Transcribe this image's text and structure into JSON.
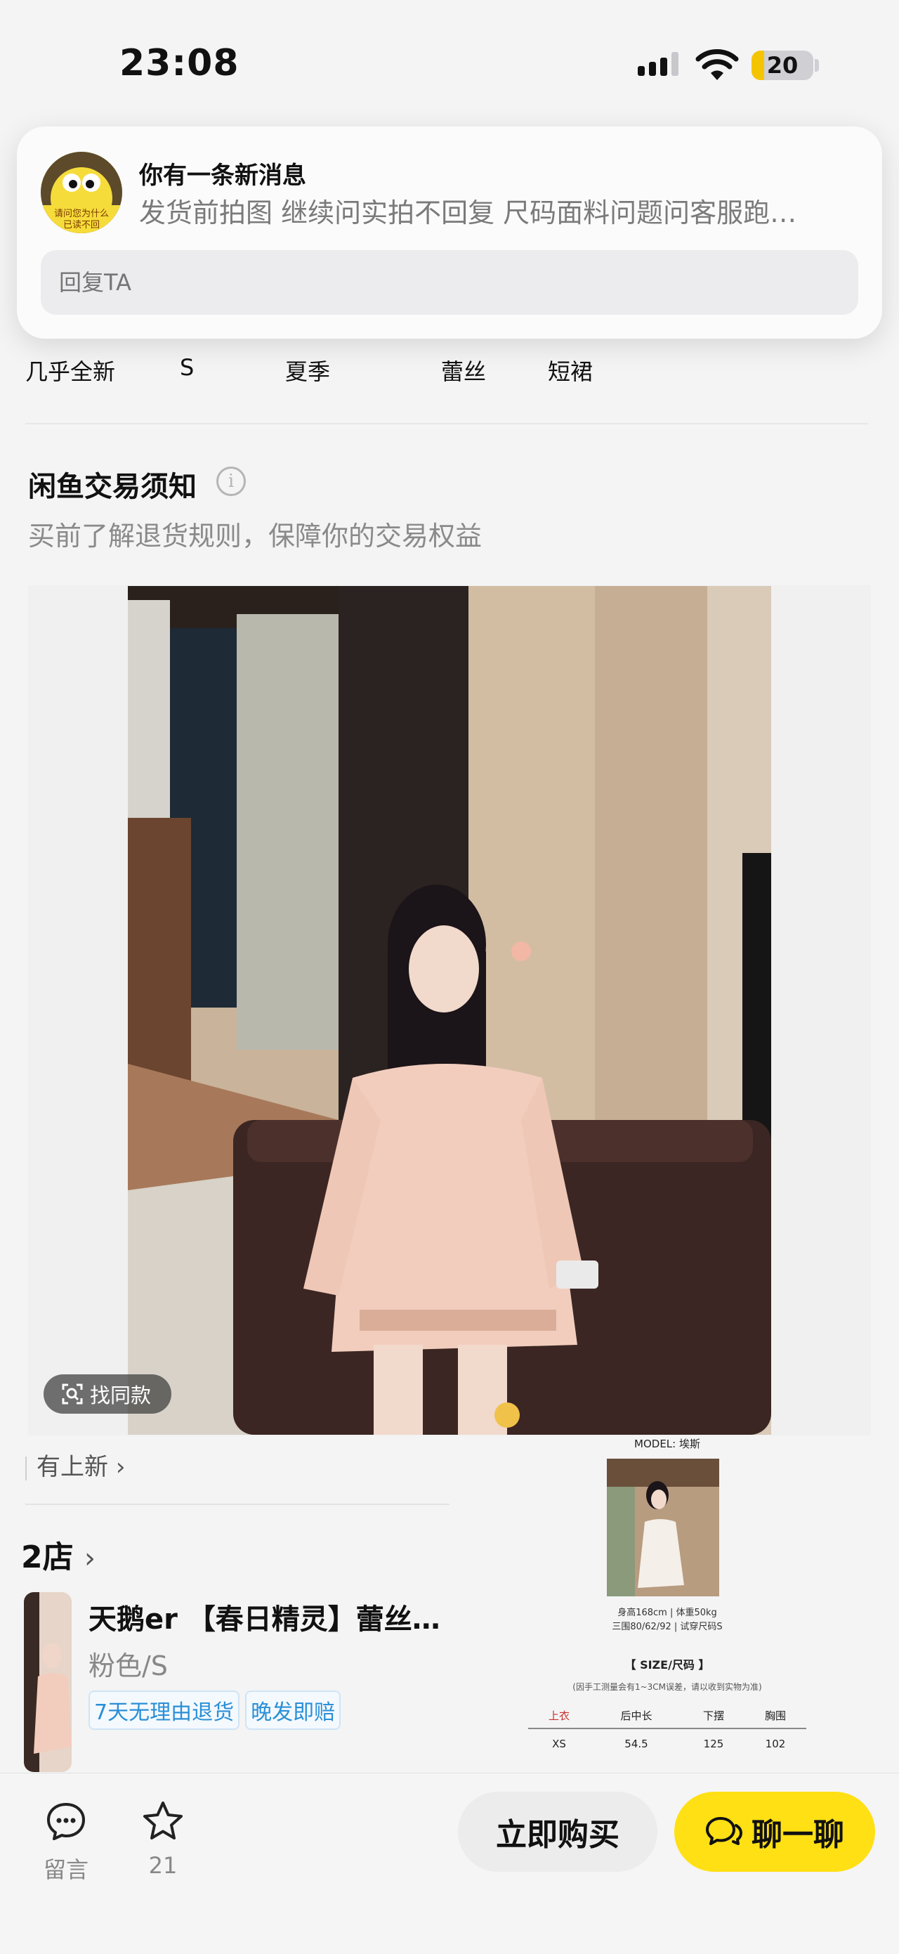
{
  "status_bar": {
    "time": "23:08",
    "battery": "20",
    "battery_level": 0.2
  },
  "notification": {
    "title": "你有一条新消息",
    "message": "发货前拍图 继续问实拍不回复 尺码面料问题问客服跑…",
    "avatar_text_1": "请问您为什么",
    "avatar_text_2": "已读不回",
    "reply_placeholder": "回复TA"
  },
  "tags": [
    "几乎全新",
    "S",
    "夏季",
    "蕾丝",
    "短裙"
  ],
  "rules": {
    "title": "闲鱼交易须知",
    "subtitle": "买前了解退货规则，保障你的交易权益"
  },
  "gallery": {
    "find_same_label": "找同款"
  },
  "shop": {
    "new_arrivals_label": "有上新",
    "name": "2店"
  },
  "product": {
    "title": "天鹅er 【春日精灵】蕾丝…",
    "spec": "粉色/S",
    "badges": [
      "7天无理由退货",
      "晚发即赔"
    ]
  },
  "size_chart": {
    "model_label": "MODEL: 埃斯",
    "stats_1": "身高168cm | 体重50kg",
    "stats_2": "三围80/62/92 | 试穿尺码S",
    "title": "【 SIZE/尺码 】",
    "note": "(因手工测量会有1~3CM误差，请以收到实物为准)",
    "headers": [
      "上衣",
      "后中长",
      "下摆",
      "胸围"
    ],
    "rows": [
      [
        "XS",
        "54.5",
        "125",
        "102"
      ]
    ]
  },
  "bottom_bar": {
    "comment_label": "留言",
    "favorite_count": "21",
    "buy_label": "立即购买",
    "chat_label": "聊一聊"
  },
  "colors": {
    "accent": "#ffe014",
    "badge_blue": "#2a8fd6"
  }
}
